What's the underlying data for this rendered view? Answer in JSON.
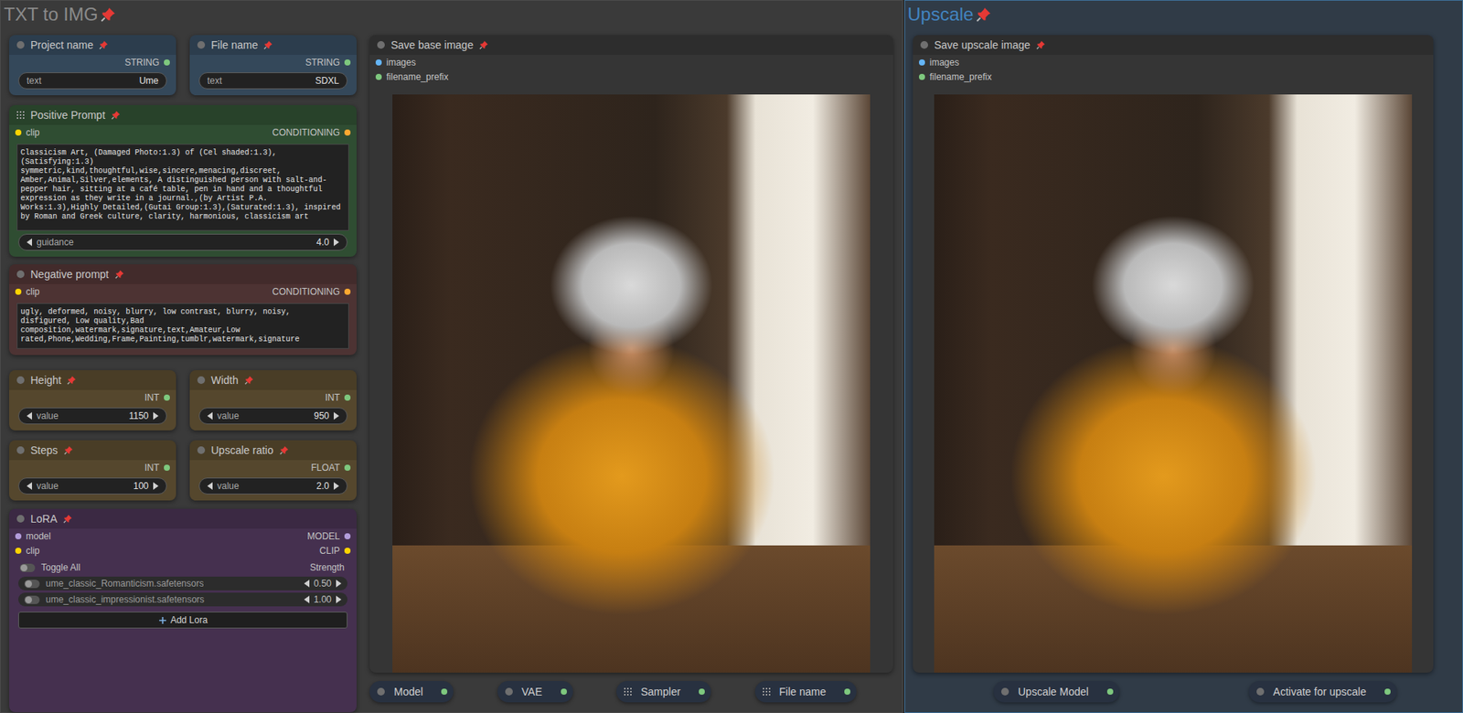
{
  "main": {
    "title": "TXT to IMG",
    "text_nodes": [
      {
        "title": "Project name",
        "output": {
          "name": "STRING",
          "color": "#7ec87e"
        },
        "label": "text",
        "value": "Ume"
      },
      {
        "title": "File name",
        "output": {
          "name": "STRING",
          "color": "#7ec87e"
        },
        "label": "text",
        "value": "SDXL"
      }
    ],
    "positive": {
      "title": "Positive Prompt",
      "input": {
        "name": "clip",
        "color": "#ffd500"
      },
      "output": {
        "name": "CONDITIONING",
        "color": "#ffa931"
      },
      "text": "Classicism Art, (Damaged Photo:1.3) of (Cel shaded:1.3),(Satisfying:1.3) symmetric,kind,thoughtful,wise,sincere,menacing,discreet, Amber,Animal,Silver,elements, A distinguished person with salt-and-pepper hair, sitting at a café table, pen in hand and a thoughtful expression as they write in a journal.,(by Artist P.A. Works:1.3),Highly Detailed,(Gutai Group:1.3),(Saturated:1.3), inspired by Roman and Greek culture, clarity, harmonious, classicism art",
      "widget": {
        "label": "guidance",
        "value": "4.0"
      }
    },
    "negative": {
      "title": "Negative prompt",
      "input": {
        "name": "clip",
        "color": "#ffd500"
      },
      "output": {
        "name": "CONDITIONING",
        "color": "#ffa931"
      },
      "text": "ugly, deformed, noisy, blurry, low contrast, blurry, noisy, disfigured, Low quality,Bad composition,watermark,signature,text,Amateur,Low rated,Phone,Wedding,Frame,Painting,tumblr,watermark,signature"
    },
    "number_nodes": [
      {
        "title": "Height",
        "output": {
          "name": "INT",
          "color": "#7ec87e"
        },
        "label": "value",
        "value": "1150"
      },
      {
        "title": "Width",
        "output": {
          "name": "INT",
          "color": "#7ec87e"
        },
        "label": "value",
        "value": "950"
      },
      {
        "title": "Steps",
        "output": {
          "name": "INT",
          "color": "#7ec87e"
        },
        "label": "value",
        "value": "100"
      },
      {
        "title": "Upscale ratio",
        "output": {
          "name": "FLOAT",
          "color": "#7ec87e"
        },
        "label": "value",
        "value": "2.0"
      }
    ],
    "lora": {
      "title": "LoRA",
      "slots": [
        {
          "input": {
            "name": "model",
            "color": "#b39ddb"
          },
          "output": {
            "name": "MODEL",
            "color": "#b39ddb"
          }
        },
        {
          "input": {
            "name": "clip",
            "color": "#ffd500"
          },
          "output": {
            "name": "CLIP",
            "color": "#ffd500"
          }
        }
      ],
      "toggle_all": {
        "label": "Toggle All",
        "on": false
      },
      "strength_label": "Strength",
      "items": [
        {
          "name": "ume_classic_Romanticism.safetensors",
          "on": false,
          "strength": "0.50"
        },
        {
          "name": "ume_classic_impressionist.safetensors",
          "on": false,
          "strength": "1.00"
        }
      ],
      "add_button": "Add Lora"
    },
    "save": {
      "title": "Save base image",
      "inputs": [
        {
          "name": "images",
          "color": "#64b5f6"
        },
        {
          "name": "filename_prefix",
          "color": "#7ec87e"
        }
      ]
    },
    "collapsed": [
      {
        "title": "Model",
        "kind": "plain"
      },
      {
        "title": "VAE",
        "kind": "plain"
      },
      {
        "title": "Sampler",
        "kind": "grouped"
      },
      {
        "title": "File name",
        "kind": "grouped"
      }
    ]
  },
  "upscale": {
    "title": "Upscale",
    "save": {
      "title": "Save upscale image",
      "inputs": [
        {
          "name": "images",
          "color": "#64b5f6"
        },
        {
          "name": "filename_prefix",
          "color": "#7ec87e"
        }
      ]
    },
    "collapsed": [
      {
        "title": "Upscale Model",
        "kind": "plain"
      },
      {
        "title": "Activate for upscale",
        "kind": "plain"
      }
    ]
  }
}
